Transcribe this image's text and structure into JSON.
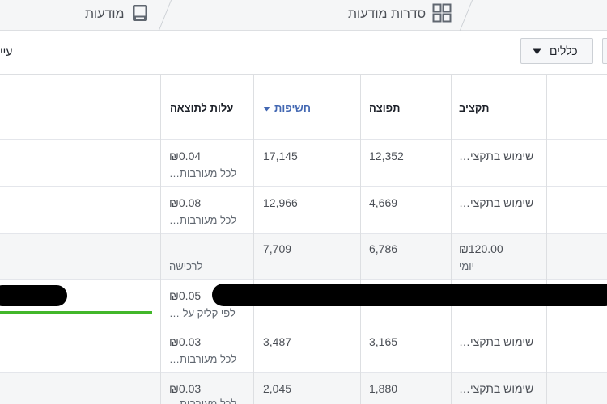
{
  "tabs": [
    {
      "label": "מודעות",
      "icon": "ad-icon"
    },
    {
      "label": "סדרות מודעות",
      "icon": "grid-icon"
    }
  ],
  "toolbar": {
    "rules_label": "כללים",
    "cut_label": "עיי"
  },
  "columns": {
    "budget": "תקציב",
    "results": "תפוצה",
    "impressions": "חשיפות",
    "cost_per_result": "עלות לתוצאה"
  },
  "rows": [
    {
      "budget": "שימוש בתקצי…",
      "budget_sub": "",
      "results": "12,352",
      "impressions": "17,145",
      "cost": "₪0.04",
      "cost_sub": "לכל מעורבות…"
    },
    {
      "budget": "שימוש בתקצי…",
      "budget_sub": "",
      "results": "4,669",
      "impressions": "12,966",
      "cost": "₪0.08",
      "cost_sub": "לכל מעורבות…"
    },
    {
      "budget": "₪120.00",
      "budget_sub": "יומי",
      "results": "6,786",
      "impressions": "7,709",
      "cost": "—",
      "cost_sub": "לרכישה"
    },
    {
      "budget": "",
      "budget_sub": "",
      "results": "",
      "impressions": "",
      "cost": "₪0.05",
      "cost_sub": "לפי קליק על …"
    },
    {
      "budget": "שימוש בתקצי…",
      "budget_sub": "",
      "results": "3,165",
      "impressions": "3,487",
      "cost": "₪0.03",
      "cost_sub": "לכל מעורבות…"
    },
    {
      "budget": "שימוש בתקצי…",
      "budget_sub": "",
      "results": "1,880",
      "impressions": "2,045",
      "cost": "₪0.03",
      "cost_sub": "לכל מעורבות…"
    }
  ],
  "colors": {
    "accent": "#4267b2",
    "progress": "#42b72a"
  }
}
